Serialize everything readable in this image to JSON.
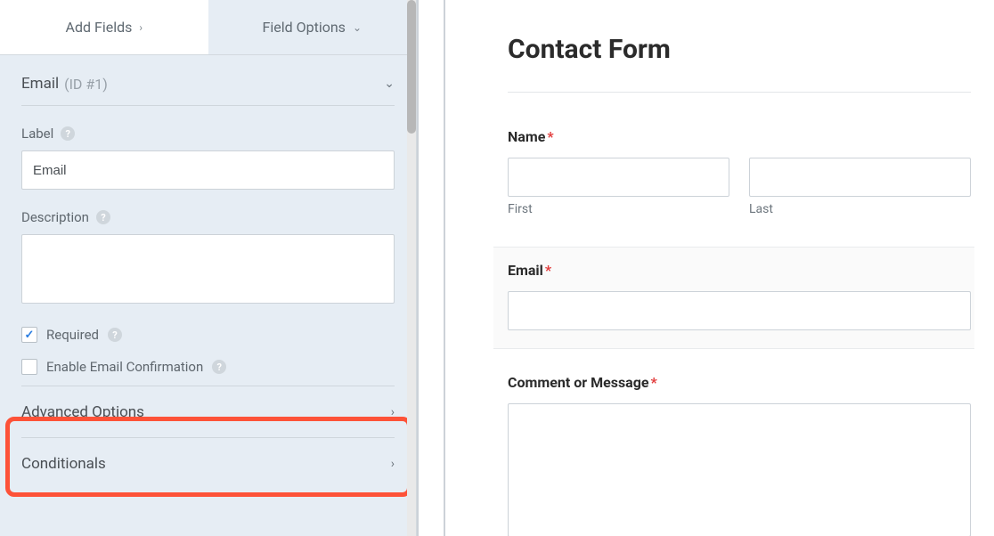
{
  "tabs": {
    "add_fields": "Add Fields",
    "field_options": "Field Options"
  },
  "field_header": {
    "name": "Email",
    "id": "(ID #1)"
  },
  "labels": {
    "label_section": "Label",
    "label_value": "Email",
    "description_section": "Description",
    "description_value": "",
    "required": "Required",
    "enable_confirmation": "Enable Email Confirmation",
    "advanced_options": "Advanced Options",
    "conditionals": "Conditionals"
  },
  "preview": {
    "form_title": "Contact Form",
    "name_label": "Name",
    "first_sub": "First",
    "last_sub": "Last",
    "email_label": "Email",
    "comment_label": "Comment or Message",
    "required_mark": "*"
  }
}
